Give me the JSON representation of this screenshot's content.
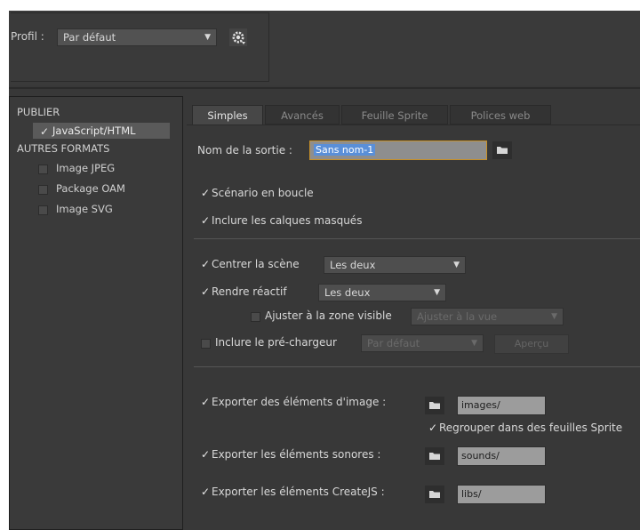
{
  "header": {
    "profile_label": "Profil :",
    "profile_value": "Par défaut"
  },
  "left_panel": {
    "section_publish": "PUBLIER",
    "publish_items": [
      {
        "label": "JavaScript/HTML",
        "checked": true,
        "selected": true
      }
    ],
    "section_other": "AUTRES FORMATS",
    "other_items": [
      {
        "label": "Image JPEG",
        "checked": false
      },
      {
        "label": "Package OAM",
        "checked": false
      },
      {
        "label": "Image SVG",
        "checked": false
      }
    ]
  },
  "tabs": [
    "Simples",
    "Avancés",
    "Feuille Sprite",
    "Polices web"
  ],
  "active_tab": "Simples",
  "output": {
    "label": "Nom de la sortie :",
    "value": "Sans nom-1"
  },
  "options": {
    "loop": "Scénario en boucle",
    "hidden_layers": "Inclure les calques masqués",
    "center_stage": "Centrer la scène",
    "center_stage_value": "Les deux",
    "responsive": "Rendre réactif",
    "responsive_value": "Les deux",
    "fit_visible": "Ajuster à la zone visible",
    "fit_visible_value": "Ajuster à la vue",
    "preloader": "Inclure le pré-chargeur",
    "preloader_value": "Par défaut",
    "preview_button": "Aperçu"
  },
  "exports": {
    "images_label": "Exporter des éléments d'image :",
    "images_path": "images/",
    "sprite_label": "Regrouper dans des feuilles Sprite",
    "sounds_label": "Exporter les éléments sonores :",
    "sounds_path": "sounds/",
    "createjs_label": "Exporter les éléments CreateJS :",
    "createjs_path": "libs/"
  },
  "colors": {
    "panel_bg": "#383838",
    "field_bg": "#9c9c9c",
    "selection": "#5a8fd8",
    "focus_border": "#c89028"
  }
}
